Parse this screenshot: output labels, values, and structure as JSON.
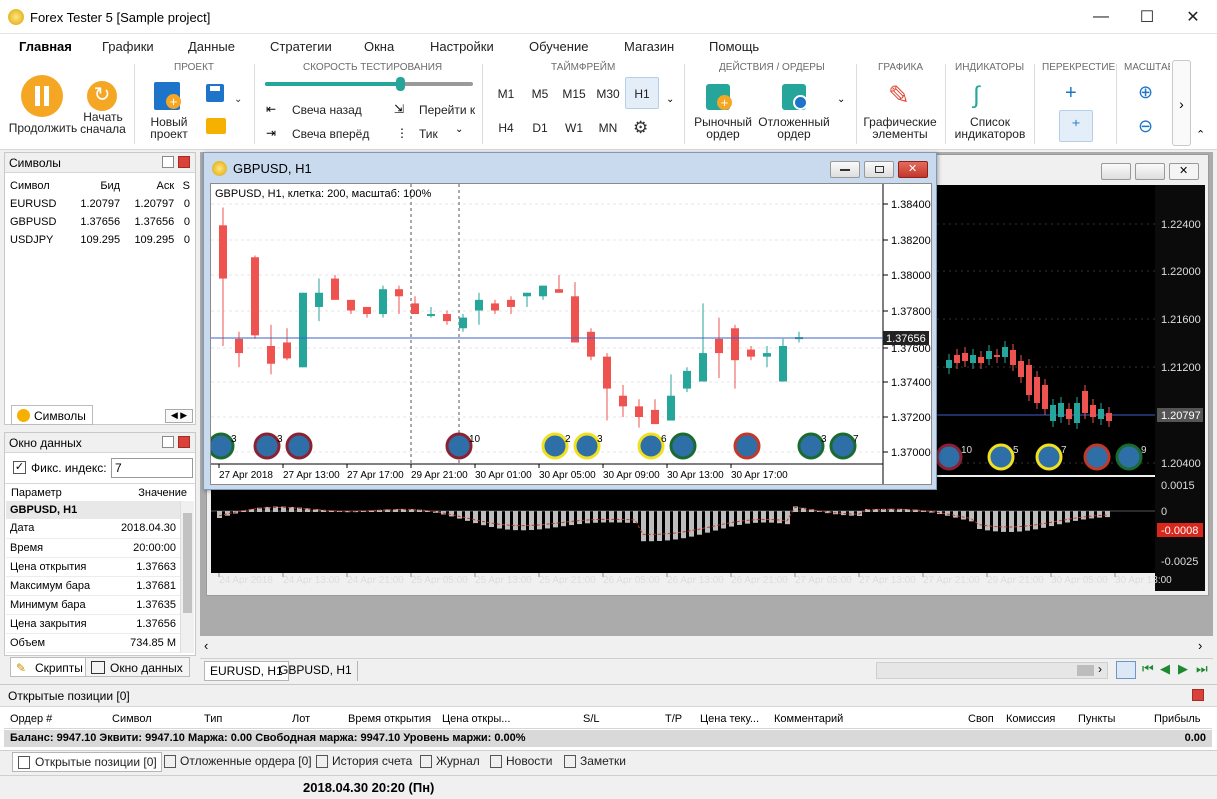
{
  "app": {
    "title": "Forex Tester 5  [Sample project]"
  },
  "menu": {
    "tabs": [
      "Главная",
      "Графики",
      "Данные",
      "Стратегии",
      "Окна",
      "Настройки",
      "Обучение",
      "Магазин",
      "Помощь"
    ]
  },
  "ribbon": {
    "groups": {
      "project": "ПРОЕКТ",
      "speed": "СКОРОСТЬ ТЕСТИРОВАНИЯ",
      "timeframe": "ТАЙМФРЕЙМ",
      "actions": "ДЕЙСТВИЯ / ОРДЕРЫ",
      "graphics": "ГРАФИКА",
      "indicators": "ИНДИКАТОРЫ",
      "crosshair": "ПЕРЕКРЕСТИЕ",
      "scale": "МАСШТАБ"
    },
    "continue": "Продолжить",
    "restart": [
      "Начать",
      "сначала"
    ],
    "new_project": [
      "Новый",
      "проект"
    ],
    "candle_back": "Свеча назад",
    "candle_forward": "Свеча вперёд",
    "goto": "Перейти к",
    "tick": "Тик",
    "speed_level": 0.65,
    "timeframes_row1": [
      "M1",
      "M5",
      "M15",
      "M30",
      "H1"
    ],
    "timeframes_row2": [
      "H4",
      "D1",
      "W1",
      "MN"
    ],
    "market_order": [
      "Рыночный",
      "ордер"
    ],
    "pending_order": [
      "Отложенный",
      "ордер"
    ],
    "graphic_elements": [
      "Графические",
      "элементы"
    ],
    "indicator_list": [
      "Список",
      "индикаторов"
    ]
  },
  "symbols": {
    "title": "Символы",
    "headers": [
      "Символ",
      "Бид",
      "Аск",
      "S"
    ],
    "rows": [
      [
        "EURUSD",
        "1.20797",
        "1.20797",
        "0"
      ],
      [
        "GBPUSD",
        "1.37656",
        "1.37656",
        "0"
      ],
      [
        "USDJPY",
        "109.295",
        "109.295",
        "0"
      ]
    ],
    "tab": "Символы"
  },
  "datawin": {
    "title": "Окно данных",
    "fixed_index_label": "Фикс. индекс:",
    "fixed_index_value": "7",
    "headers": [
      "Параметр",
      "Значение"
    ],
    "section": "GBPUSD, H1",
    "rows": [
      [
        "Дата",
        "2018.04.30"
      ],
      [
        "Время",
        "20:00:00"
      ],
      [
        "Цена открытия",
        "1.37663"
      ],
      [
        "Максимум бара",
        "1.37681"
      ],
      [
        "Минимум бара",
        "1.37635"
      ],
      [
        "Цена закрытия",
        "1.37656"
      ],
      [
        "Объем",
        "734.85 M"
      ]
    ],
    "tabs": [
      "Скрипты",
      "Окно данных"
    ]
  },
  "eurusd": {
    "price_labels": [
      "1.22400",
      "1.22000",
      "1.21600",
      "1.21200",
      "1.20797",
      "1.20400"
    ],
    "current_price": "1.20797",
    "osc_labels": [
      "0.0015",
      "0",
      "-0.0008",
      "-0.0025"
    ],
    "time_labels": [
      "24 Apr 2018",
      "24 Apr 13:00",
      "24 Apr 21:00",
      "25 Apr 05:00",
      "25 Apr 13:00",
      "25 Apr 21:00",
      "26 Apr 05:00",
      "26 Apr 13:00",
      "26 Apr 21:00",
      "27 Apr 05:00",
      "27 Apr 13:00",
      "27 Apr 21:00",
      "29 Apr 21:00",
      "30 Apr 05:00",
      "30 Apr 13:00"
    ],
    "event_numbers": [
      "10",
      "5",
      "7",
      "9"
    ]
  },
  "gbpusd": {
    "window_title": "GBPUSD, H1",
    "info": "GBPUSD, H1, клетка: 200, масштаб: 100%",
    "price_labels": [
      "1.38400",
      "1.38200",
      "1.38000",
      "1.37800",
      "1.37600",
      "1.37400",
      "1.37200",
      "1.37000"
    ],
    "current_price": "1.37656",
    "time_labels": [
      "27 Apr 2018",
      "27 Apr 13:00",
      "27 Apr 17:00",
      "29 Apr 21:00",
      "30 Apr 01:00",
      "30 Apr 05:00",
      "30 Apr 09:00",
      "30 Apr 13:00",
      "30 Apr 17:00"
    ],
    "event_numbers": [
      "3",
      "3",
      "10",
      "2",
      "3",
      "6",
      "3",
      "7"
    ]
  },
  "chart_tabs": [
    "EURUSD, H1",
    "GBPUSD, H1"
  ],
  "positions": {
    "title": "Открытые позиции [0]",
    "headers": [
      "Ордер #",
      "Символ",
      "Тип",
      "Лот",
      "Время открытия",
      "Цена откры...",
      "S/L",
      "T/P",
      "Цена теку...",
      "Комментарий",
      "Своп",
      "Комиссия",
      "Пункты",
      "Прибыль"
    ],
    "balance_line": "Баланс: 9947.10 Эквити: 9947.10 Маржа: 0.00 Свободная маржа: 9947.10 Уровень маржи: 0.00%",
    "balance_profit": "0.00",
    "tabs": [
      "Открытые позиции [0]",
      "Отложенные ордера [0]",
      "История счета",
      "Журнал",
      "Новости",
      "Заметки"
    ]
  },
  "status": {
    "datetime": "2018.04.30 20:20 (Пн)"
  },
  "colors": {
    "bull": "#26a69a",
    "bear": "#ef5350",
    "accent": "#f5a623",
    "dark_bg": "#000000"
  }
}
